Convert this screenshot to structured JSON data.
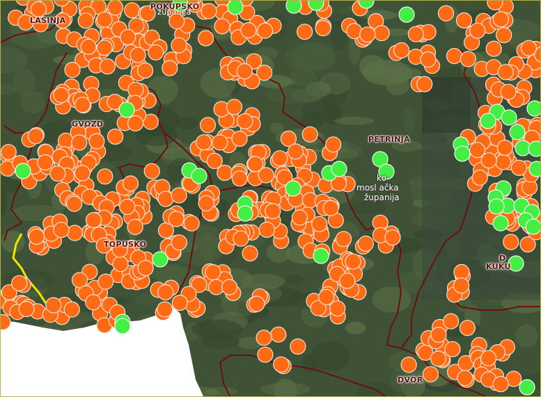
{
  "map": {
    "labels": {
      "lasinja": "LASINJA",
      "pokupsko": "POKUPSKO",
      "zupanija_top": "županija",
      "gvozd": "GVOZD",
      "petrinja": "PETRINJA",
      "region_1": "ko-",
      "region_2": "mosl ačka",
      "region_3": "županija",
      "topusko": "TOPUSKO",
      "dvor_kuku": "D",
      "kukuruzari": "KUKU",
      "dvor": "DVOR"
    },
    "colors": {
      "terrain": "#3f5236",
      "terrain_light": "#5b7048",
      "border": "#6b0f0f",
      "state_border": "#f2e600",
      "marker_orange": "#ff6a14",
      "marker_green": "#44ee44",
      "marker_stroke": "#f4e0d0",
      "outside_area": "#ffffff"
    },
    "marker_counts": {
      "orange": 600,
      "green": 42
    }
  }
}
